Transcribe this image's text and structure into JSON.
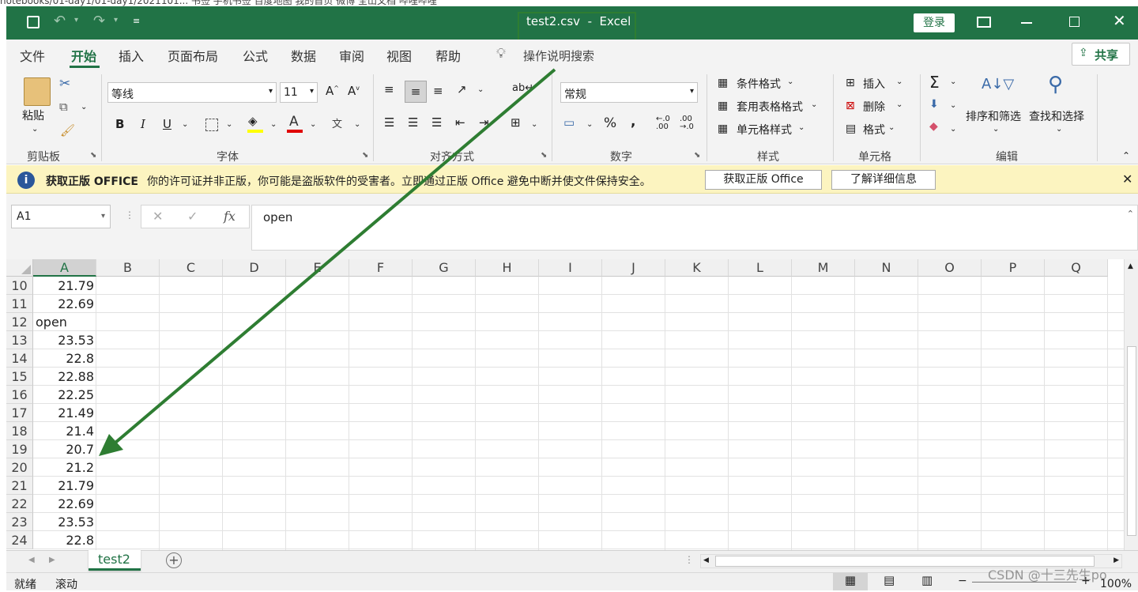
{
  "browser_strip": {
    "text": "notebooks/01-day1/01-day1/2021101...   书签   手机书签   百度地图   我的首页 微博   全山文档   哔哩哔哩"
  },
  "titlebar": {
    "doc_title": "test2.csv  -  Excel",
    "login_label": "登录"
  },
  "menu": {
    "items": [
      "文件",
      "开始",
      "插入",
      "页面布局",
      "公式",
      "数据",
      "审阅",
      "视图",
      "帮助"
    ],
    "search_hint": "操作说明搜索",
    "share_label": "共享"
  },
  "ribbon": {
    "clipboard": {
      "paste_label": "粘贴",
      "group_label": "剪贴板"
    },
    "font": {
      "font_name": "等线",
      "font_size": "11",
      "group_label": "字体",
      "bold": "B",
      "italic": "I",
      "underline": "U"
    },
    "alignment": {
      "group_label": "对齐方式"
    },
    "number": {
      "format": "常规",
      "group_label": "数字",
      "percent": "%",
      "comma": ","
    },
    "styles": {
      "conditional": "条件格式",
      "table": "套用表格格式",
      "cell_style": "单元格样式",
      "group_label": "样式"
    },
    "cells": {
      "insert": "插入",
      "delete": "删除",
      "format": "格式",
      "group_label": "单元格"
    },
    "editing": {
      "sort_filter": "排序和筛选",
      "find_select": "查找和选择",
      "group_label": "编辑"
    }
  },
  "infobar": {
    "title": "获取正版 OFFICE",
    "message": "你的许可证并非正版，你可能是盗版软件的受害者。立即通过正版 Office 避免中断并使文件保持安全。",
    "btn_genuine": "获取正版 Office",
    "btn_learn": "了解详细信息"
  },
  "formula": {
    "name_box": "A1",
    "fx": "fx",
    "content": "open"
  },
  "columns": [
    "A",
    "B",
    "C",
    "D",
    "E",
    "F",
    "G",
    "H",
    "I",
    "J",
    "K",
    "L",
    "M",
    "N",
    "O",
    "P",
    "Q"
  ],
  "rows": [
    {
      "num": "10",
      "a": "21.79",
      "text": false
    },
    {
      "num": "11",
      "a": "22.69",
      "text": false
    },
    {
      "num": "12",
      "a": "open",
      "text": true
    },
    {
      "num": "13",
      "a": "23.53",
      "text": false
    },
    {
      "num": "14",
      "a": "22.8",
      "text": false
    },
    {
      "num": "15",
      "a": "22.88",
      "text": false
    },
    {
      "num": "16",
      "a": "22.25",
      "text": false
    },
    {
      "num": "17",
      "a": "21.49",
      "text": false
    },
    {
      "num": "18",
      "a": "21.4",
      "text": false
    },
    {
      "num": "19",
      "a": "20.7",
      "text": false
    },
    {
      "num": "20",
      "a": "21.2",
      "text": false
    },
    {
      "num": "21",
      "a": "21.79",
      "text": false
    },
    {
      "num": "22",
      "a": "22.69",
      "text": false
    },
    {
      "num": "23",
      "a": "23.53",
      "text": false
    },
    {
      "num": "24",
      "a": "22.8",
      "text": false
    }
  ],
  "sheet": {
    "tab": "test2"
  },
  "status": {
    "ready": "就绪",
    "scroll": "滚动",
    "zoom": "100%",
    "watermark": "CSDN @十三先生po"
  },
  "colors": {
    "excel_green": "#217346",
    "annotation": "#2e7d32"
  }
}
